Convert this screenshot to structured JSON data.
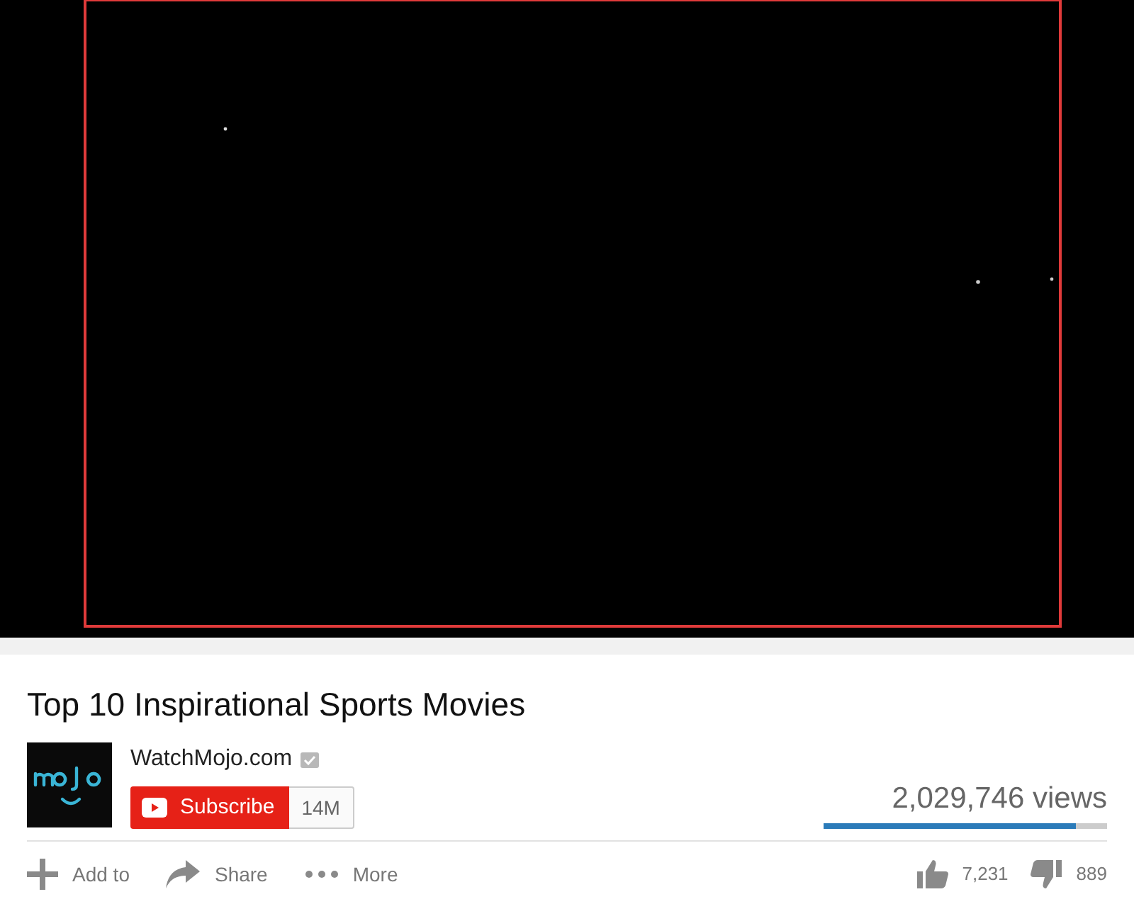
{
  "title": "Top 10 Inspirational Sports Movies",
  "channel": {
    "name": "WatchMojo.com",
    "verified": true,
    "subscribe_label": "Subscribe",
    "subscriber_count": "14M"
  },
  "views": "2,029,746 views",
  "ratings": {
    "level": 0.89,
    "likes": "7,231",
    "dislikes": "889"
  },
  "actions": [
    {
      "kind": "add",
      "label": "Add to"
    },
    {
      "kind": "share",
      "label": "Share"
    },
    {
      "kind": "more",
      "label": "More"
    }
  ]
}
